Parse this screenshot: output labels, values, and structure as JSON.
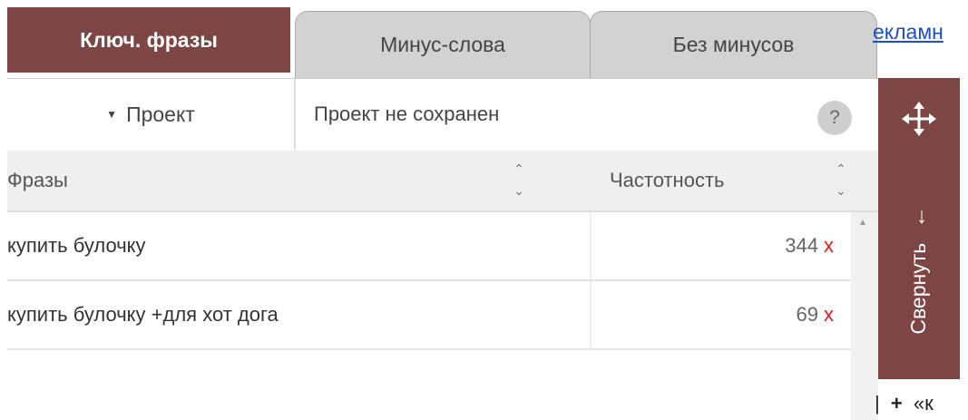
{
  "tabs": {
    "keyphrases": "Ключ. фразы",
    "minus_words": "Минус-слова",
    "no_minus": "Без минусов"
  },
  "external_link": "екламн",
  "project": {
    "label": "Проект",
    "status": "Проект не сохранен",
    "help": "?"
  },
  "table": {
    "headers": {
      "phrases": "Фразы",
      "frequency": "Частотность"
    },
    "rows": [
      {
        "phrase": "купить булочку",
        "frequency": "344",
        "delete": "x"
      },
      {
        "phrase": "купить булочку +для хот дога",
        "frequency": "69",
        "delete": "x"
      }
    ]
  },
  "side_panel": {
    "collapse_label": "Свернуть",
    "collapse_arrow": "←"
  },
  "bottom_snippet": {
    "prefix": "|",
    "plus": "+",
    "text": "«к"
  },
  "colors": {
    "accent": "#7d4543",
    "delete": "#e02020",
    "link": "#1a4fd1"
  }
}
